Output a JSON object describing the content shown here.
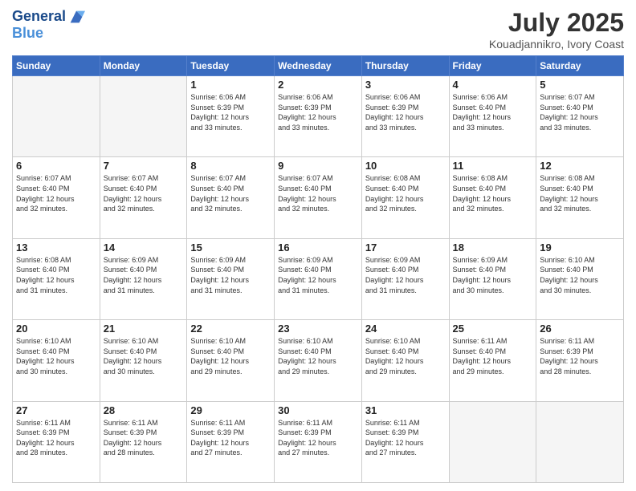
{
  "header": {
    "logo_line1": "General",
    "logo_line2": "Blue",
    "month_year": "July 2025",
    "location": "Kouadjannikro, Ivory Coast"
  },
  "days_of_week": [
    "Sunday",
    "Monday",
    "Tuesday",
    "Wednesday",
    "Thursday",
    "Friday",
    "Saturday"
  ],
  "weeks": [
    [
      {
        "day": "",
        "info": ""
      },
      {
        "day": "",
        "info": ""
      },
      {
        "day": "1",
        "info": "Sunrise: 6:06 AM\nSunset: 6:39 PM\nDaylight: 12 hours\nand 33 minutes."
      },
      {
        "day": "2",
        "info": "Sunrise: 6:06 AM\nSunset: 6:39 PM\nDaylight: 12 hours\nand 33 minutes."
      },
      {
        "day": "3",
        "info": "Sunrise: 6:06 AM\nSunset: 6:39 PM\nDaylight: 12 hours\nand 33 minutes."
      },
      {
        "day": "4",
        "info": "Sunrise: 6:06 AM\nSunset: 6:40 PM\nDaylight: 12 hours\nand 33 minutes."
      },
      {
        "day": "5",
        "info": "Sunrise: 6:07 AM\nSunset: 6:40 PM\nDaylight: 12 hours\nand 33 minutes."
      }
    ],
    [
      {
        "day": "6",
        "info": "Sunrise: 6:07 AM\nSunset: 6:40 PM\nDaylight: 12 hours\nand 32 minutes."
      },
      {
        "day": "7",
        "info": "Sunrise: 6:07 AM\nSunset: 6:40 PM\nDaylight: 12 hours\nand 32 minutes."
      },
      {
        "day": "8",
        "info": "Sunrise: 6:07 AM\nSunset: 6:40 PM\nDaylight: 12 hours\nand 32 minutes."
      },
      {
        "day": "9",
        "info": "Sunrise: 6:07 AM\nSunset: 6:40 PM\nDaylight: 12 hours\nand 32 minutes."
      },
      {
        "day": "10",
        "info": "Sunrise: 6:08 AM\nSunset: 6:40 PM\nDaylight: 12 hours\nand 32 minutes."
      },
      {
        "day": "11",
        "info": "Sunrise: 6:08 AM\nSunset: 6:40 PM\nDaylight: 12 hours\nand 32 minutes."
      },
      {
        "day": "12",
        "info": "Sunrise: 6:08 AM\nSunset: 6:40 PM\nDaylight: 12 hours\nand 32 minutes."
      }
    ],
    [
      {
        "day": "13",
        "info": "Sunrise: 6:08 AM\nSunset: 6:40 PM\nDaylight: 12 hours\nand 31 minutes."
      },
      {
        "day": "14",
        "info": "Sunrise: 6:09 AM\nSunset: 6:40 PM\nDaylight: 12 hours\nand 31 minutes."
      },
      {
        "day": "15",
        "info": "Sunrise: 6:09 AM\nSunset: 6:40 PM\nDaylight: 12 hours\nand 31 minutes."
      },
      {
        "day": "16",
        "info": "Sunrise: 6:09 AM\nSunset: 6:40 PM\nDaylight: 12 hours\nand 31 minutes."
      },
      {
        "day": "17",
        "info": "Sunrise: 6:09 AM\nSunset: 6:40 PM\nDaylight: 12 hours\nand 31 minutes."
      },
      {
        "day": "18",
        "info": "Sunrise: 6:09 AM\nSunset: 6:40 PM\nDaylight: 12 hours\nand 30 minutes."
      },
      {
        "day": "19",
        "info": "Sunrise: 6:10 AM\nSunset: 6:40 PM\nDaylight: 12 hours\nand 30 minutes."
      }
    ],
    [
      {
        "day": "20",
        "info": "Sunrise: 6:10 AM\nSunset: 6:40 PM\nDaylight: 12 hours\nand 30 minutes."
      },
      {
        "day": "21",
        "info": "Sunrise: 6:10 AM\nSunset: 6:40 PM\nDaylight: 12 hours\nand 30 minutes."
      },
      {
        "day": "22",
        "info": "Sunrise: 6:10 AM\nSunset: 6:40 PM\nDaylight: 12 hours\nand 29 minutes."
      },
      {
        "day": "23",
        "info": "Sunrise: 6:10 AM\nSunset: 6:40 PM\nDaylight: 12 hours\nand 29 minutes."
      },
      {
        "day": "24",
        "info": "Sunrise: 6:10 AM\nSunset: 6:40 PM\nDaylight: 12 hours\nand 29 minutes."
      },
      {
        "day": "25",
        "info": "Sunrise: 6:11 AM\nSunset: 6:40 PM\nDaylight: 12 hours\nand 29 minutes."
      },
      {
        "day": "26",
        "info": "Sunrise: 6:11 AM\nSunset: 6:39 PM\nDaylight: 12 hours\nand 28 minutes."
      }
    ],
    [
      {
        "day": "27",
        "info": "Sunrise: 6:11 AM\nSunset: 6:39 PM\nDaylight: 12 hours\nand 28 minutes."
      },
      {
        "day": "28",
        "info": "Sunrise: 6:11 AM\nSunset: 6:39 PM\nDaylight: 12 hours\nand 28 minutes."
      },
      {
        "day": "29",
        "info": "Sunrise: 6:11 AM\nSunset: 6:39 PM\nDaylight: 12 hours\nand 27 minutes."
      },
      {
        "day": "30",
        "info": "Sunrise: 6:11 AM\nSunset: 6:39 PM\nDaylight: 12 hours\nand 27 minutes."
      },
      {
        "day": "31",
        "info": "Sunrise: 6:11 AM\nSunset: 6:39 PM\nDaylight: 12 hours\nand 27 minutes."
      },
      {
        "day": "",
        "info": ""
      },
      {
        "day": "",
        "info": ""
      }
    ]
  ]
}
